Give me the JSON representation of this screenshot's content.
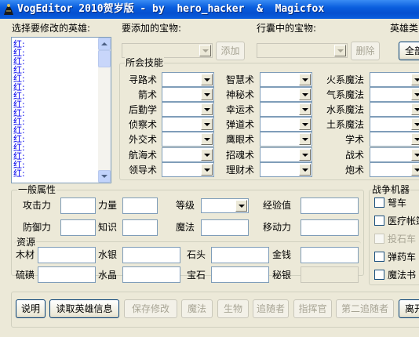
{
  "window": {
    "title": "VogEditor 2010贺岁版 - by  hero_hacker  &  Magicfox"
  },
  "left": {
    "heroes_label": "选择要修改的英雄:",
    "hero_items": [
      "红:",
      "红:",
      "红:",
      "红:",
      "红:",
      "红:",
      "红:",
      "红:",
      "红:",
      "红:",
      "红:",
      "红:",
      "红:",
      "红:",
      "红:",
      "红:"
    ]
  },
  "treasure": {
    "add_label": "要添加的宝物:",
    "add_button": "添加",
    "bag_label": "行囊中的宝物:",
    "delete_button": "删除",
    "hero_type_label": "英雄类",
    "all_button": "全部"
  },
  "skills": {
    "group_title": "所会技能",
    "col1": [
      "寻路术",
      "箭术",
      "后勤学",
      "侦察术",
      "外交术",
      "航海术",
      "领导术"
    ],
    "col2": [
      "智慧术",
      "神秘术",
      "幸运术",
      "弹道术",
      "鹰眼术",
      "招魂术",
      "理财术"
    ],
    "col3": [
      "火系魔法",
      "气系魔法",
      "水系魔法",
      "土系魔法",
      "学术",
      "战术",
      "炮术"
    ]
  },
  "general": {
    "group_title": "一般属性",
    "attack": "攻击力",
    "power": "力量",
    "level": "等级",
    "experience": "经验值",
    "defense": "防御力",
    "knowledge": "知识",
    "magic": "魔法",
    "movement": "移动力"
  },
  "resources": {
    "group_title": "资源",
    "wood": "木材",
    "mercury": "水银",
    "ore": "石头",
    "gold": "金钱",
    "sulfur": "硫磺",
    "crystal": "水晶",
    "gems": "宝石",
    "mithril": "秘银"
  },
  "war_machines": {
    "group_title": "战争机器",
    "items": [
      {
        "label": "弩车",
        "enabled": true
      },
      {
        "label": "医疗帐篷",
        "enabled": true
      },
      {
        "label": "投石车",
        "enabled": false
      },
      {
        "label": "弹药车",
        "enabled": true
      },
      {
        "label": "魔法书",
        "enabled": true
      }
    ]
  },
  "bottom_buttons": {
    "help": "说明",
    "read_hero": "读取英雄信息",
    "save": "保存修改",
    "magic": "魔法",
    "creatures": "生物",
    "followers": "追随者",
    "commander": "指挥官",
    "second_follower": "第二追随者",
    "exit": "离开"
  }
}
